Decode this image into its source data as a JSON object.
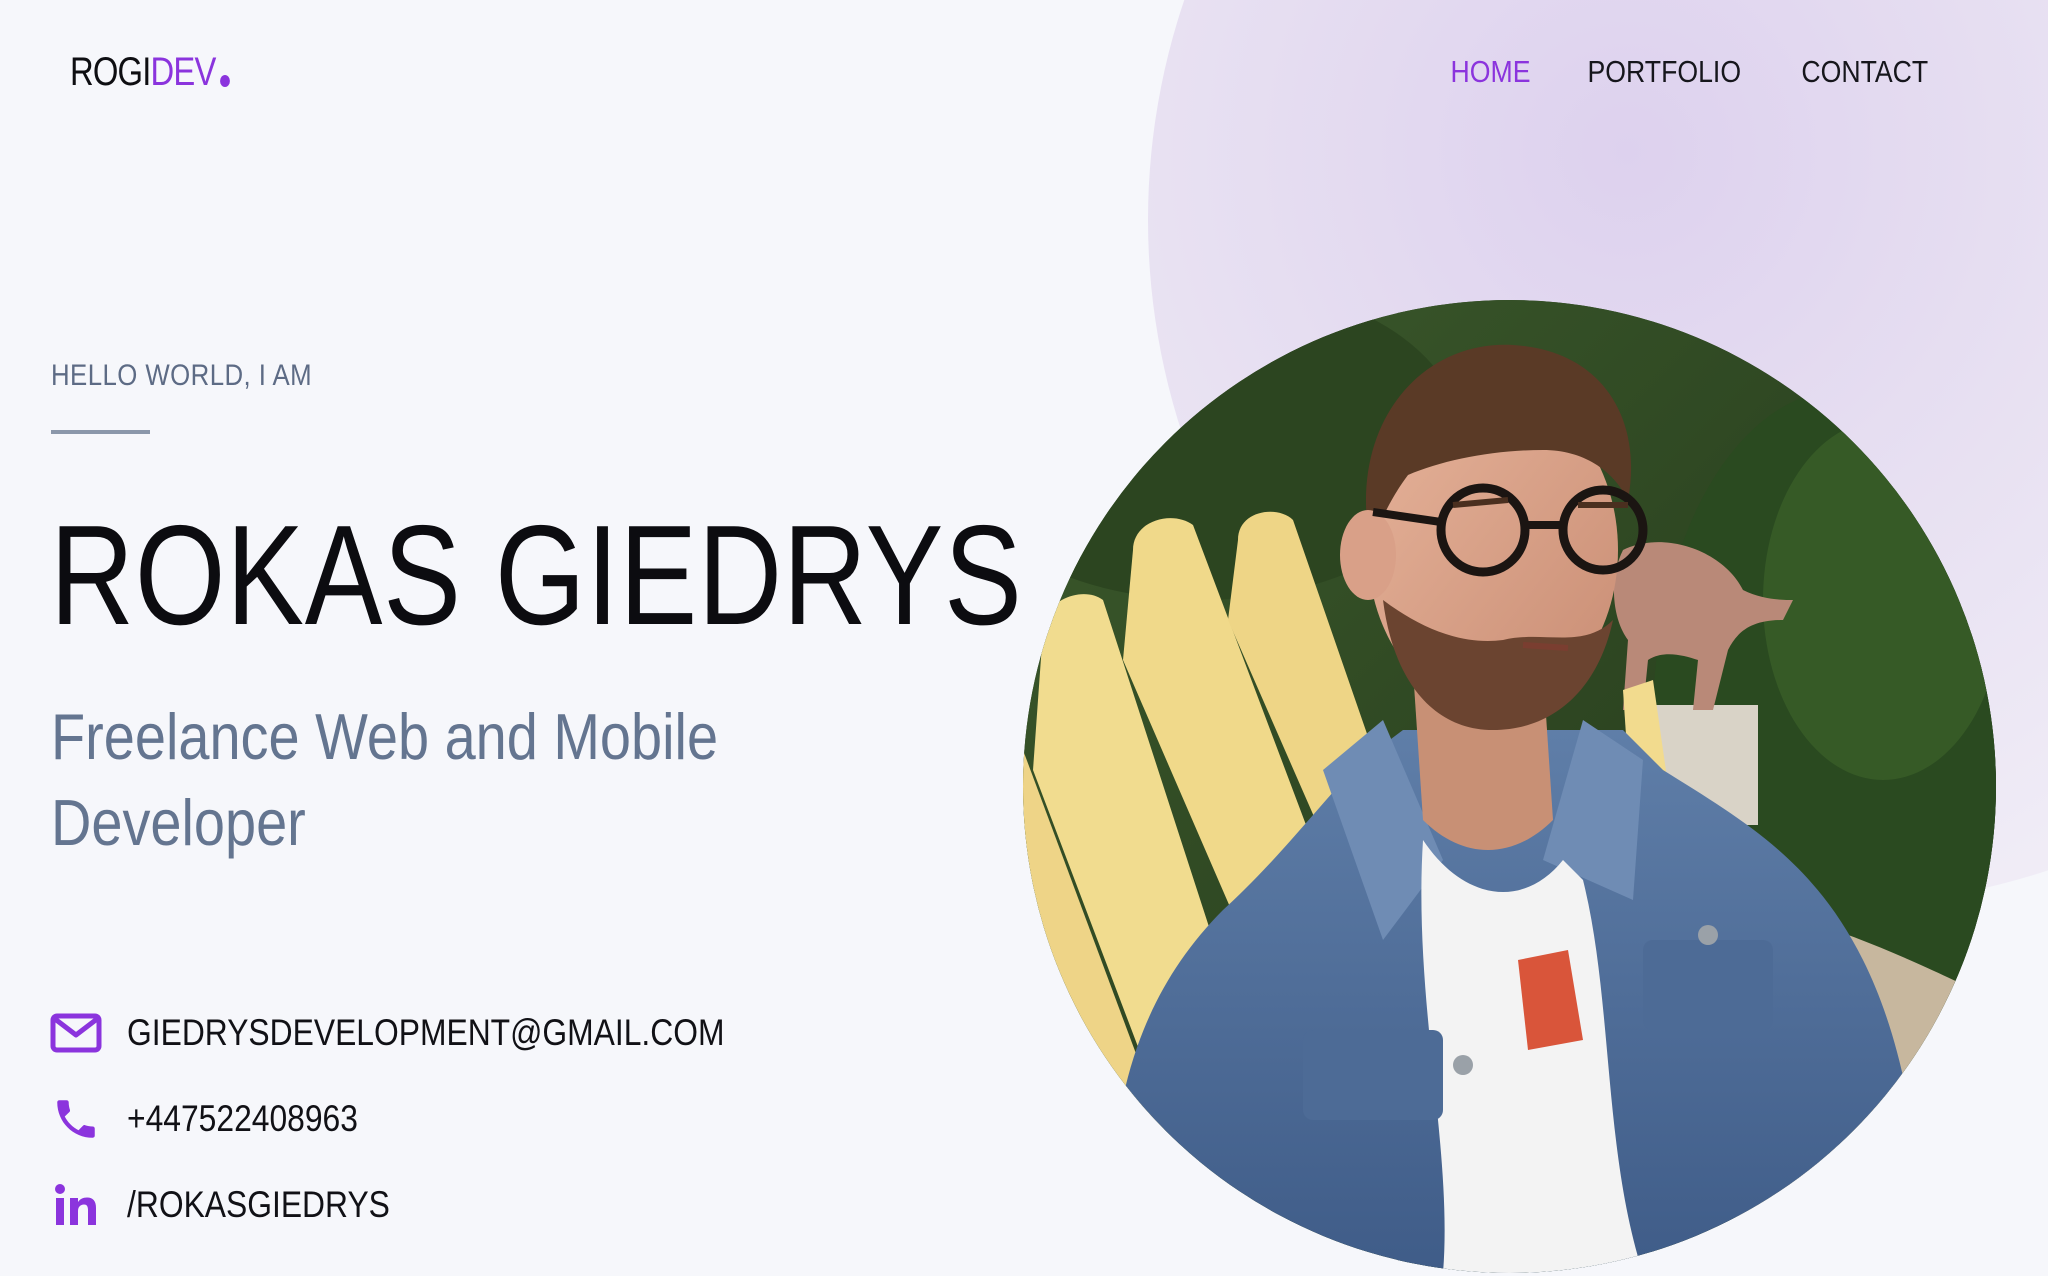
{
  "logo": {
    "text_main": "ROGI",
    "text_accent": "DEV"
  },
  "nav": {
    "items": [
      {
        "label": "HOME",
        "active": true
      },
      {
        "label": "PORTFOLIO",
        "active": false
      },
      {
        "label": "CONTACT",
        "active": false
      }
    ]
  },
  "hero": {
    "eyebrow": "HELLO WORLD, I AM",
    "name": "ROKAS GIEDRYS",
    "tagline": "Freelance Web and Mobile Developer"
  },
  "contacts": {
    "email": "GIEDRYSDEVELOPMENT@GMAIL.COM",
    "phone": "+447522408963",
    "linkedin": "/ROKASGIEDRYS"
  },
  "icons": {
    "email": "envelope-icon",
    "phone": "phone-icon",
    "linkedin": "linkedin-icon"
  },
  "colors": {
    "accent": "#8b34dd",
    "background": "#f6f7fb",
    "muted_text": "#647590",
    "blob": "#e4dcf0"
  }
}
